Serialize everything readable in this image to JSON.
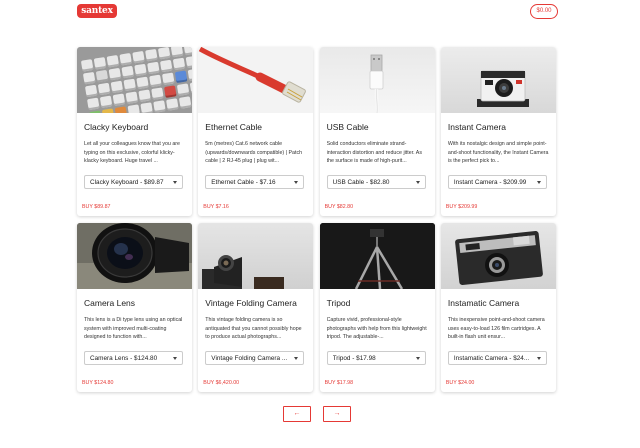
{
  "header": {
    "logo_text": "santex",
    "cart_total": "$0.00"
  },
  "colors": {
    "accent": "#e53935"
  },
  "products": [
    {
      "name": "Clacky Keyboard",
      "description": "Let all your colleagues know that you are typing on this exclusive, colorful klicky-klacky keyboard. Huge travel ...",
      "selected_variant": "Clacky Keyboard - $89.87",
      "buy_label": "BUY $89.87",
      "image_icon": "keyboard-image"
    },
    {
      "name": "Ethernet Cable",
      "description": "5m (metres) Cat.6 network cable (upwards/downwards compatible) | Patch cable | 2 RJ-45 plug | plug wit...",
      "selected_variant": "Ethernet Cable - $7.16",
      "buy_label": "BUY $7.16",
      "image_icon": "ethernet-cable-image"
    },
    {
      "name": "USB Cable",
      "description": "Solid conductors eliminate strand-interaction distortion and reduce jitter. As the surface is made of high-purit...",
      "selected_variant": "USB Cable - $82.80",
      "buy_label": "BUY $82.80",
      "image_icon": "usb-cable-image"
    },
    {
      "name": "Instant Camera",
      "description": "With its nostalgic design and simple point-and-shoot functionality, the Instant Camera is the perfect pick to...",
      "selected_variant": "Instant Camera - $209.99",
      "buy_label": "BUY $209.99",
      "image_icon": "instant-camera-image"
    },
    {
      "name": "Camera Lens",
      "description": "This lens is a Di type lens using an optical system with improved multi-coating designed to function with...",
      "selected_variant": "Camera Lens - $124.80",
      "buy_label": "BUY $124.80",
      "image_icon": "camera-lens-image"
    },
    {
      "name": "Vintage Folding Camera",
      "description": "This vintage folding camera is so antiquated that you cannot possibly hope to produce actual photographs...",
      "selected_variant": "Vintage Folding Camera ...",
      "buy_label": "BUY $6,420.00",
      "image_icon": "vintage-camera-image"
    },
    {
      "name": "Tripod",
      "description": "Capture vivid, professional-style photographs with help from this lightweight tripod. The adjustable-...",
      "selected_variant": "Tripod - $17.98",
      "buy_label": "BUY $17.98",
      "image_icon": "tripod-image"
    },
    {
      "name": "Instamatic Camera",
      "description": "This inexpensive point-and-shoot camera uses easy-to-load 126 film cartridges. A built-in flash unit ensur...",
      "selected_variant": "Instamatic Camera - $24...",
      "buy_label": "BUY $24.00",
      "image_icon": "instamatic-camera-image"
    }
  ],
  "pagination": {
    "prev_label": "←",
    "next_label": "→"
  }
}
